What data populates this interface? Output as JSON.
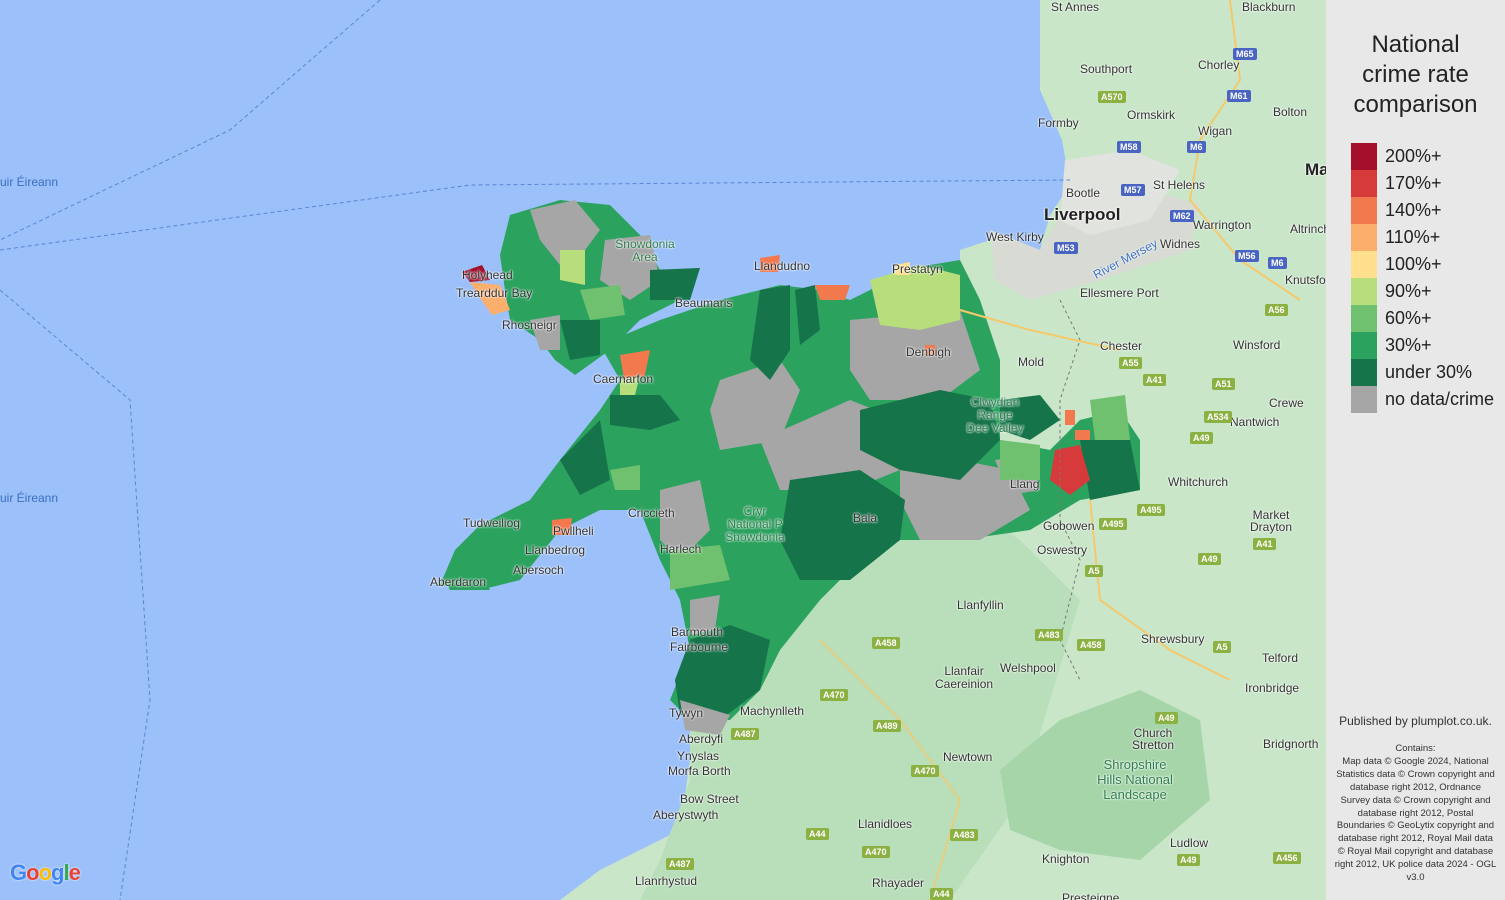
{
  "legend": {
    "title_lines": [
      "National",
      "crime rate",
      "comparison"
    ],
    "items": [
      {
        "label": "200%+",
        "color": "#a50f2c"
      },
      {
        "label": "170%+",
        "color": "#d73a3a"
      },
      {
        "label": "140%+",
        "color": "#f2784e"
      },
      {
        "label": "110%+",
        "color": "#fcae6d"
      },
      {
        "label": "100%+",
        "color": "#fee08f"
      },
      {
        "label": "90%+",
        "color": "#b7de7a"
      },
      {
        "label": "60%+",
        "color": "#6fc06f"
      },
      {
        "label": "30%+",
        "color": "#2ca25f"
      },
      {
        "label": "under 30%",
        "color": "#16744a"
      },
      {
        "label": "no data/crime",
        "color": "#a6a6a6"
      }
    ]
  },
  "attribution": {
    "published": "Published by plumplot.co.uk.",
    "contains": "Contains:\nMap data © Google 2024, National Statistics data © Crown copyright and database right 2012, Ordnance Survey data © Crown copyright and database right 2012, Postal Boundaries © GeoLytix copyright and database right 2012, Royal Mail data © Royal Mail copyright and database right 2012, UK police data 2024 - OGL v3.0"
  },
  "map": {
    "google_logo": "Google",
    "places": [
      "St Annes",
      "Blackburn",
      "Southport",
      "Chorley",
      "Bolton",
      "Ormskirk",
      "Formby",
      "Wigan",
      "Bootle",
      "St Helens",
      "Liverpool",
      "West Kirby",
      "Warrington",
      "Widnes",
      "Altrincha",
      "Ellesmere Port",
      "Knutsfo",
      "Chester",
      "Winsford",
      "Mold",
      "Crewe",
      "Nantwich",
      "Whitchurch",
      "Market\nDrayton",
      "Gobowen",
      "Oswestry",
      "Llanfyllin",
      "Shrewsbury",
      "Telford",
      "Welshpool",
      "Llanfair\nCaereinion",
      "Ironbridge",
      "Machynlleth",
      "Church\nStretton",
      "Bridgnorth",
      "Aberdyfi",
      "Ynyslas",
      "Morfa Borth",
      "Newtown",
      "Bow Street",
      "Aberystwyth",
      "Llanidloes",
      "Ludlow",
      "Knighton",
      "Llanrhystud",
      "Rhayader",
      "Presteigne",
      "Bala",
      "Harlech",
      "Barmouth",
      "Fairbourne",
      "Tywyn",
      "Abersoch",
      "Aberdaron",
      "Tudweiliog",
      "Pwllheli",
      "Llanbedrog",
      "Holyhead",
      "Trearddur Bay",
      "Rhosneigr",
      "Beaumaris",
      "Llandudno",
      "Prestatyn",
      "Denbigh",
      "Caernarfon",
      "Criccieth",
      "Ma",
      "Llang"
    ],
    "sea_labels": [
      "Muir Éireann",
      "Muir Éireann"
    ],
    "river_labels": [
      "River Mersey"
    ],
    "park_labels": [
      "Snowdonia\nArea",
      "Cryr\nNational P\nSnowdonia",
      "Clwydian\nRange\nDee Valley",
      "Shropshire\nHills National\nLandscape"
    ],
    "road_labels": [
      "M65",
      "M61",
      "A570",
      "M58",
      "M6",
      "M57",
      "M62",
      "M53",
      "M56",
      "M6",
      "A55",
      "A41",
      "A51",
      "A534",
      "A49",
      "A56",
      "A495",
      "A495",
      "A5",
      "A483",
      "A458",
      "A458",
      "A5",
      "A49",
      "A49",
      "A470",
      "A489",
      "A470",
      "A487",
      "A44",
      "A483",
      "A470",
      "A44",
      "A49",
      "A456",
      "A41",
      "A487"
    ]
  }
}
